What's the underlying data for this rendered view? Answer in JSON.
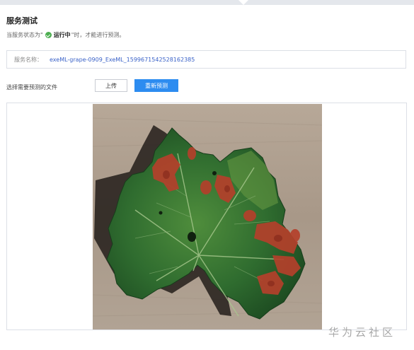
{
  "title": "服务测试",
  "status": {
    "prefix": "当服务状态为\"",
    "state": "运行中",
    "suffix": "\"时，才能进行预测。",
    "icon": "check-circle-icon",
    "color": "#4cae50"
  },
  "service": {
    "label": "服务名称：",
    "name": "exeML-grape-0909_ExeML_1599671542528162385"
  },
  "upload": {
    "label": "选择需要预测的文件",
    "upload_button": "上传",
    "repredict_button": "重新预测"
  },
  "preview": {
    "image": "grape-leaf-photo",
    "accent": "#2d8cf0"
  },
  "watermark": "华为云社区"
}
